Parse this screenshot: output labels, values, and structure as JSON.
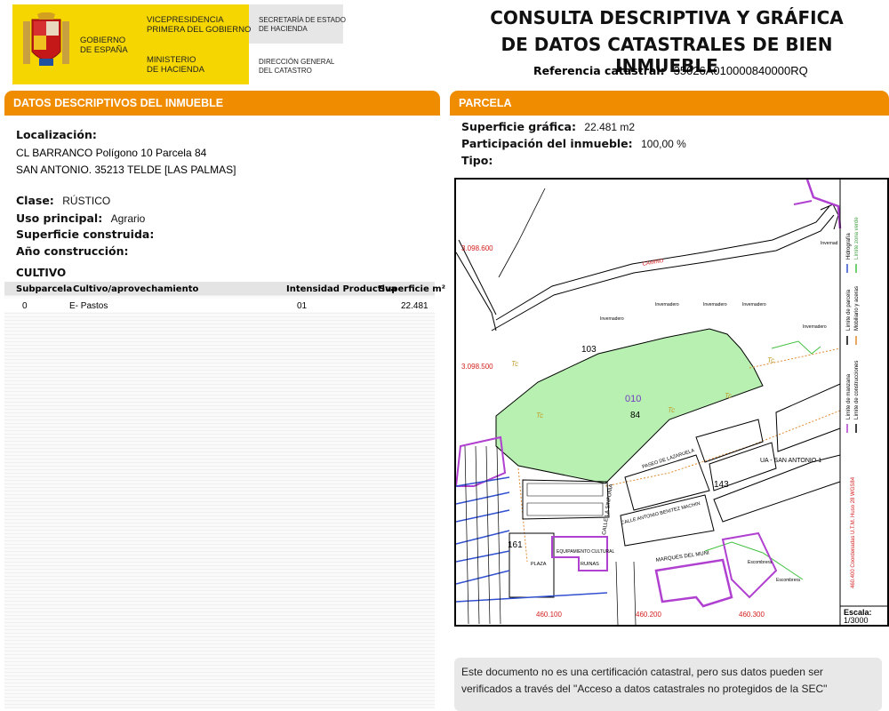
{
  "header": {
    "gov_line1": "GOBIERNO",
    "gov_line2": "DE ESPAÑA",
    "vice_line1": "VICEPRESIDENCIA",
    "vice_line2": "PRIMERA DEL GOBIERNO",
    "min_line1": "MINISTERIO",
    "min_line2": "DE HACIENDA",
    "sec_line1": "SECRETARÍA DE ESTADO",
    "sec_line2": "DE HACIENDA",
    "dir_line1": "DIRECCIÓN GENERAL",
    "dir_line2": "DEL CATASTRO",
    "title_line1": "CONSULTA DESCRIPTIVA Y GRÁFICA",
    "title_line2": "DE DATOS CATASTRALES DE BIEN INMUEBLE",
    "ref_label": "Referencia catastral:",
    "ref_value": "35026A010000840000RQ"
  },
  "left": {
    "section_title": "DATOS DESCRIPTIVOS DEL INMUEBLE",
    "loc_label": "Localización:",
    "loc_line1": "CL BARRANCO  Polígono 10 Parcela 84",
    "loc_line2": "SAN ANTONIO. 35213 TELDE [LAS PALMAS]",
    "clase_label": "Clase:",
    "clase_value": "RÚSTICO",
    "uso_label": "Uso principal:",
    "uso_value": "Agrario",
    "sup_label": "Superficie construida:",
    "anio_label": "Año construcción:",
    "cultivo_title": "CULTIVO",
    "table": {
      "headers": [
        "Subparcela",
        "Cultivo/aprovechamiento",
        "Intensidad Productiva",
        "Superficie m²"
      ],
      "rows": [
        [
          "0",
          "E- Pastos",
          "01",
          "22.481"
        ]
      ]
    }
  },
  "right": {
    "section_title": "PARCELA",
    "supg_label": "Superficie gráfica:",
    "supg_value": "22.481 m2",
    "part_label": "Participación del inmueble:",
    "part_value": "100,00 %",
    "tipo_label": "Tipo:",
    "map": {
      "coord_y1": "3.098.600",
      "coord_y2": "3.098.500",
      "coord_x1": "460.100",
      "coord_x2": "460.200",
      "coord_x3": "460.300",
      "parcel_num": "84",
      "poligono_num": "010",
      "lbl_103": "103",
      "lbl_143": "143",
      "lbl_161": "161",
      "camino": "CAMINO",
      "invernadero": "Invernadero",
      "invernad": "Invernad",
      "tc": "Tc",
      "ua": "UA - SAN ANTONIO 1",
      "paseo": "PASEO DE LAZARUELA",
      "calle_sinfonia": "CALLE LA SINFONIA",
      "calle_antonio": "CALLE ANTONIO BENITEZ MACHIN",
      "equipamiento": "EQUIPAMIENTO CULTURAL",
      "plaza": "PLAZA",
      "ruinas": "RUINAS",
      "marques": "MARQUES DEL MUNI",
      "escombrera": "Escombrera",
      "legend_hidro": "Hidrografía",
      "legend_verde": "Límite zona verde",
      "legend_parcela": "Límite de parcela",
      "legend_mob": "Mobiliario y aceras",
      "legend_const": "Límite de construcciones",
      "legend_manz": "Límite de manzana",
      "coords_note": "460.400 Coordenadas U.T.M. Huso 28 WGS84",
      "escala_label": "Escala:",
      "escala_value": "1/3000"
    },
    "notice": "Este documento no es una certificación catastral, pero sus datos pueden ser verificados a través del \"Acceso a datos catastrales no protegidos de la SEC\""
  },
  "colors": {
    "accent_orange": "#f08c00",
    "header_yellow": "#f5d600",
    "parcel_green": "#b7f0b0",
    "coord_red": "#d42020",
    "street_purple": "#b040d0"
  }
}
